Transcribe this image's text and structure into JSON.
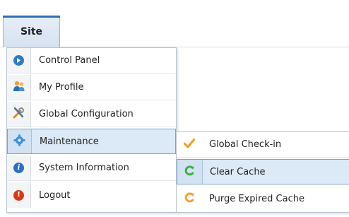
{
  "menubar": {
    "site_label": "Site"
  },
  "menu": {
    "items": [
      {
        "label": "Control Panel",
        "icon": "control-panel-icon"
      },
      {
        "label": "My Profile",
        "icon": "user-icon"
      },
      {
        "label": "Global Configuration",
        "icon": "tools-icon"
      },
      {
        "label": "Maintenance",
        "icon": "gear-icon",
        "active": true
      },
      {
        "label": "System Information",
        "icon": "info-icon"
      },
      {
        "label": "Logout",
        "icon": "logout-icon"
      }
    ]
  },
  "submenu": {
    "items": [
      {
        "label": "Global Check-in",
        "icon": "checkmark-icon"
      },
      {
        "label": "Clear Cache",
        "icon": "refresh-icon",
        "active": true
      },
      {
        "label": "Purge Expired Cache",
        "icon": "refresh-icon"
      }
    ]
  },
  "colors": {
    "accent": "#2f6fb4",
    "active_bg": "#dce9f6",
    "active_border": "#7aa3cc"
  }
}
